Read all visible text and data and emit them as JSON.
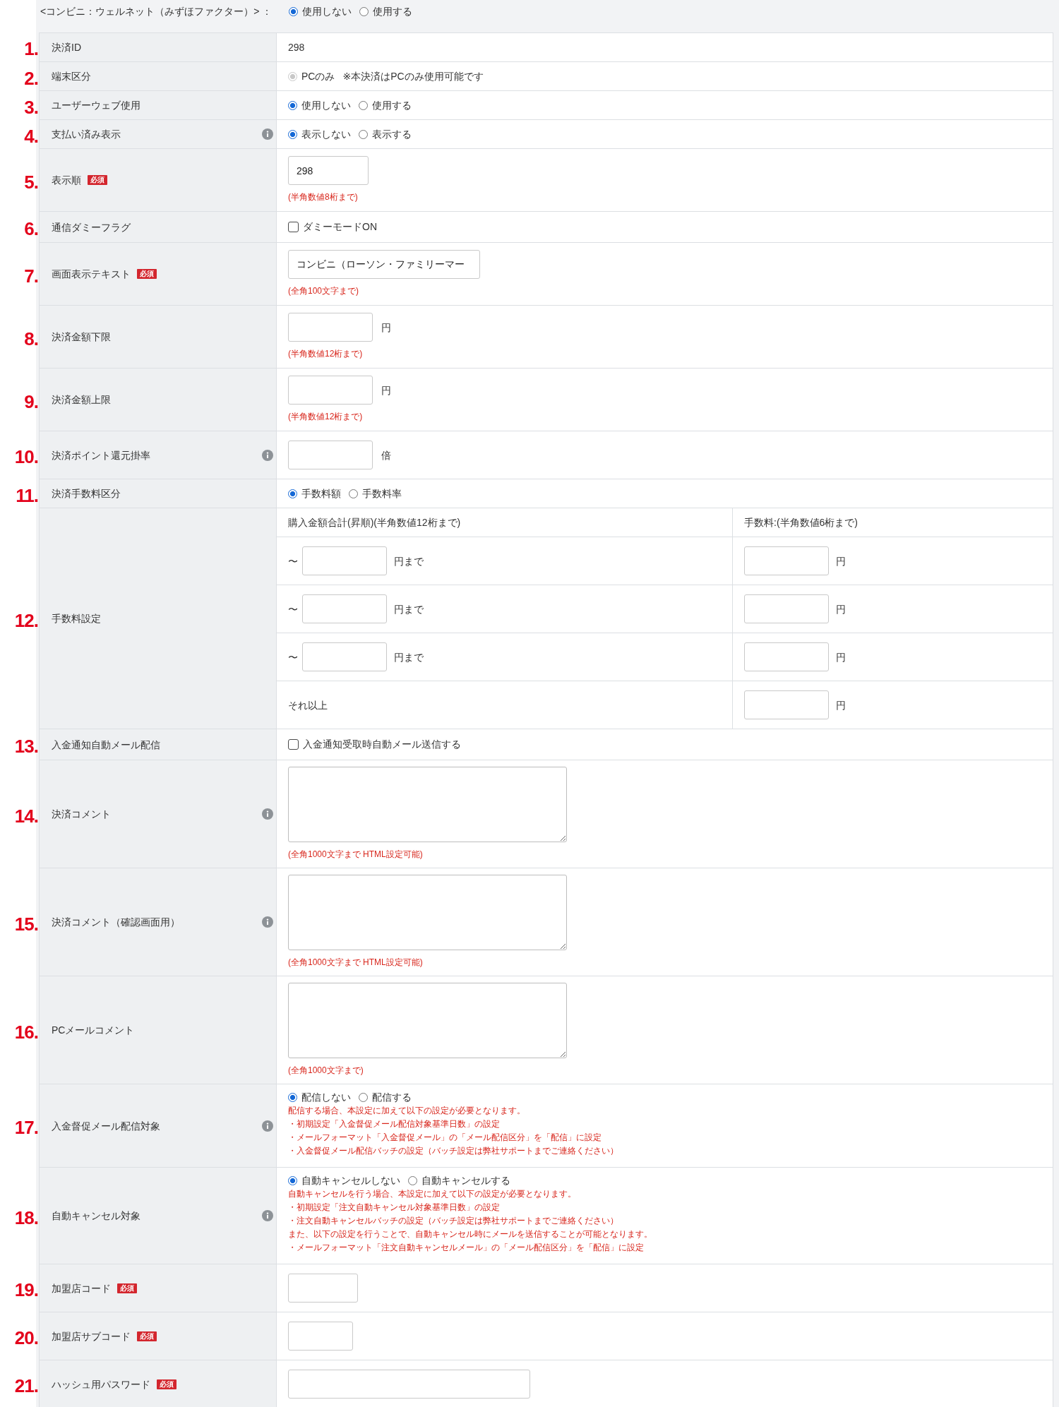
{
  "header": {
    "title": "<コンビニ：ウェルネット（みずほファクター）> ：",
    "options": [
      {
        "label": "使用しない",
        "selected": true
      },
      {
        "label": "使用する",
        "selected": false
      }
    ]
  },
  "rows": [
    {
      "number": "1.",
      "label": "決済ID",
      "info": false,
      "kind": "text",
      "value": "298"
    },
    {
      "number": "2.",
      "label": "端末区分",
      "info": false,
      "kind": "radio",
      "options": [
        {
          "label": "PCのみ",
          "selected": true,
          "disabled": true
        }
      ],
      "note": "※本決済はPCのみ使用可能です"
    },
    {
      "number": "3.",
      "label": "ユーザーウェブ使用",
      "info": false,
      "kind": "radio",
      "options": [
        {
          "label": "使用しない",
          "selected": true,
          "disabled": false
        },
        {
          "label": "使用する",
          "selected": false,
          "disabled": false
        }
      ]
    },
    {
      "number": "4.",
      "label": "支払い済み表示",
      "info": true,
      "kind": "radio",
      "options": [
        {
          "label": "表示しない",
          "selected": true,
          "disabled": false
        },
        {
          "label": "表示する",
          "selected": false,
          "disabled": false
        }
      ]
    },
    {
      "number": "5.",
      "label": "表示順",
      "badge": "必須",
      "info": false,
      "kind": "input",
      "value": "298",
      "hint": "(半角数値8桁まで)"
    },
    {
      "number": "6.",
      "label": "通信ダミーフラグ",
      "info": false,
      "kind": "checkbox",
      "option": {
        "label": "ダミーモードON",
        "checked": false
      }
    },
    {
      "number": "7.",
      "label": "画面表示テキスト",
      "badge": "必須",
      "info": false,
      "kind": "input",
      "value": "コンビニ（ローソン・ファミリーマー",
      "hint": "(全角100文字まで)"
    },
    {
      "number": "8.",
      "label": "決済金額下限",
      "info": false,
      "kind": "input",
      "unit": "円",
      "hint": "(半角数値12桁まで)"
    },
    {
      "number": "9.",
      "label": "決済金額上限",
      "info": false,
      "kind": "input",
      "unit": "円",
      "hint": "(半角数値12桁まで)"
    },
    {
      "number": "10.",
      "label": "決済ポイント還元掛率",
      "info": true,
      "kind": "input",
      "unit": "倍"
    },
    {
      "number": "11.",
      "label": "決済手数料区分",
      "info": false,
      "kind": "radio",
      "options": [
        {
          "label": "手数料額",
          "selected": true,
          "disabled": false
        },
        {
          "label": "手数料率",
          "selected": false,
          "disabled": false
        }
      ]
    },
    {
      "number": "12.",
      "label": "手数料設定",
      "info": false,
      "kind": "fee_table",
      "columns": [
        "購入金額合計(昇順)(半角数値12桁まで)",
        "手数料:(半角数値6桁まで)"
      ],
      "tiers": [
        {
          "kind": "range",
          "prefix": "〜",
          "suffix": "円まで",
          "fee_unit": "円"
        },
        {
          "kind": "range",
          "prefix": "〜",
          "suffix": "円まで",
          "fee_unit": "円"
        },
        {
          "kind": "range",
          "prefix": "〜",
          "suffix": "円まで",
          "fee_unit": "円"
        },
        {
          "kind": "rest",
          "label": "それ以上",
          "fee_unit": "円"
        }
      ]
    },
    {
      "number": "13.",
      "label": "入金通知自動メール配信",
      "info": false,
      "kind": "checkbox",
      "option": {
        "label": "入金通知受取時自動メール送信する",
        "checked": false
      }
    },
    {
      "number": "14.",
      "label": "決済コメント",
      "info": true,
      "kind": "textarea",
      "hint": "(全角1000文字まで HTML設定可能)"
    },
    {
      "number": "15.",
      "label": "決済コメント（確認画面用）",
      "info": true,
      "kind": "textarea",
      "hint": "(全角1000文字まで HTML設定可能)"
    },
    {
      "number": "16.",
      "label": "PCメールコメント",
      "info": false,
      "kind": "textarea",
      "hint": "(全角1000文字まで)"
    },
    {
      "number": "17.",
      "label": "入金督促メール配信対象",
      "info": true,
      "kind": "radio",
      "options": [
        {
          "label": "配信しない",
          "selected": true,
          "disabled": false
        },
        {
          "label": "配信する",
          "selected": false,
          "disabled": false
        }
      ],
      "notes": [
        "配信する場合、本設定に加えて以下の設定が必要となります。",
        "・初期設定「入金督促メール配信対象基準日数」の設定",
        "・メールフォーマット「入金督促メール」の「メール配信区分」を「配信」に設定",
        "・入金督促メール配信バッチの設定（バッチ設定は弊社サポートまでご連絡ください）"
      ]
    },
    {
      "number": "18.",
      "label": "自動キャンセル対象",
      "info": true,
      "kind": "radio",
      "options": [
        {
          "label": "自動キャンセルしない",
          "selected": true,
          "disabled": false
        },
        {
          "label": "自動キャンセルする",
          "selected": false,
          "disabled": false
        }
      ],
      "notes": [
        "自動キャンセルを行う場合、本設定に加えて以下の設定が必要となります。",
        "・初期設定「注文自動キャンセル対象基準日数」の設定",
        "・注文自動キャンセルバッチの設定（バッチ設定は弊社サポートまでご連絡ください）",
        "また、以下の設定を行うことで、自動キャンセル時にメールを送信することが可能となります。",
        "・メールフォーマット「注文自動キャンセルメール」の「メール配信区分」を「配信」に設定"
      ]
    },
    {
      "number": "19.",
      "label": "加盟店コード",
      "badge": "必須",
      "info": false,
      "kind": "input"
    },
    {
      "number": "20.",
      "label": "加盟店サブコード",
      "badge": "必須",
      "info": false,
      "kind": "input"
    },
    {
      "number": "21.",
      "label": "ハッシュ用パスワード",
      "badge": "必須",
      "info": false,
      "kind": "input"
    }
  ]
}
